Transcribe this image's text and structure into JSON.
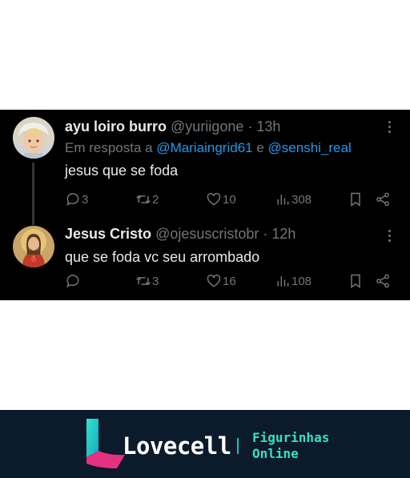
{
  "tweets": [
    {
      "display_name": "ayu loiro burro",
      "handle": "@yuriigone",
      "time": "· 13h",
      "reply_prefix": "Em resposta a",
      "reply_mention_1": "@Mariaingrid61",
      "reply_joiner": "e",
      "reply_mention_2": "@senshi_real",
      "text": "jesus que se foda",
      "replies": "3",
      "retweets": "2",
      "likes": "10",
      "views": "308",
      "avatar": "child-avatar"
    },
    {
      "display_name": "Jesus Cristo",
      "handle": "@ojesuscristobr",
      "time": "· 12h",
      "text": "que se foda vc seu arrombado",
      "replies": "",
      "retweets": "3",
      "likes": "16",
      "views": "108",
      "avatar": "jesus-avatar"
    }
  ],
  "icons": {
    "reply": "speech-bubble-icon",
    "retweet": "retweet-icon",
    "like": "heart-icon",
    "views": "bar-chart-icon",
    "bookmark": "bookmark-icon",
    "share": "share-icon",
    "more": "more-dots-icon"
  },
  "colors": {
    "background": "#000000",
    "text": "#e7e9ea",
    "muted": "#71767b",
    "link": "#1d9bf0",
    "footer": "#0c1b2c",
    "accent": "#36e0c6"
  },
  "footer": {
    "brand": "Lovecell",
    "tagline_1": "Figurinhas",
    "tagline_2": "Online"
  }
}
